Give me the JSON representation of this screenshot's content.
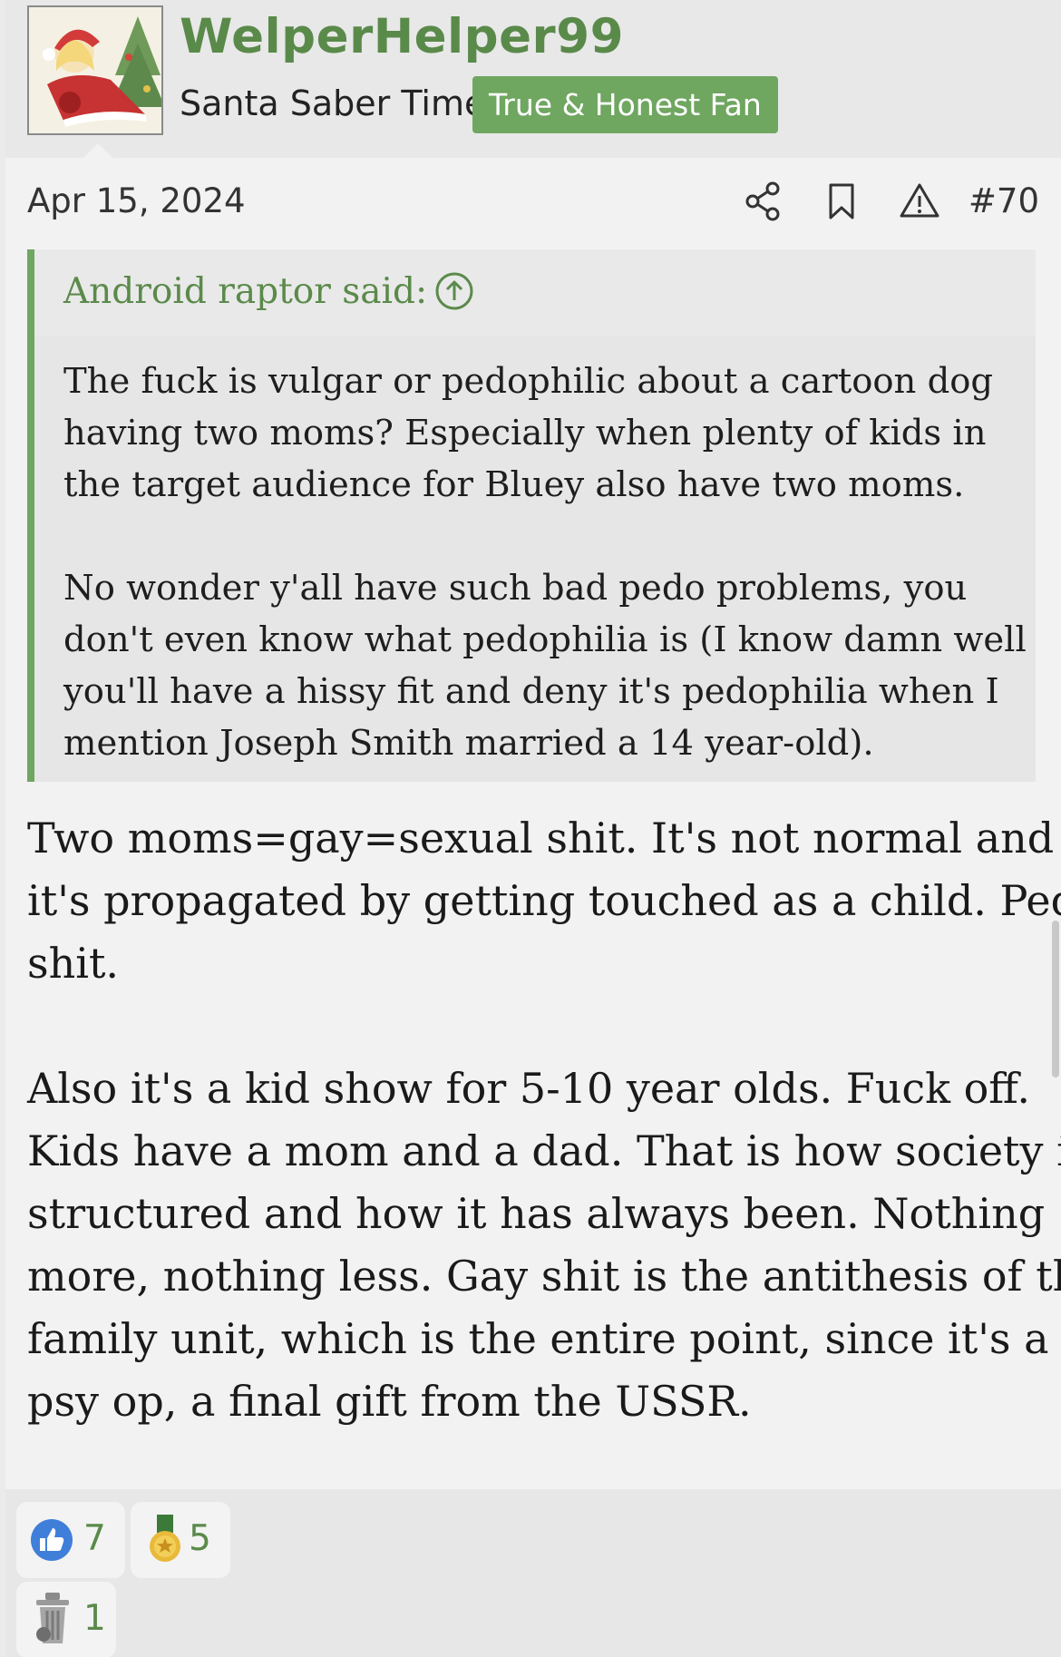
{
  "author": {
    "username": "WelperHelper99",
    "title": "Santa Saber Time",
    "banner": "True & Honest Fan",
    "avatar_icon": "santa-saber-avatar"
  },
  "post": {
    "date": "Apr 15, 2024",
    "number": "#70",
    "actions": [
      "share-icon",
      "bookmark-icon",
      "report-icon"
    ]
  },
  "quote": {
    "attribution": "Android raptor said:",
    "lines": [
      "The fuck is vulgar or pedophilic about a cartoon dog",
      "having two moms? Especially when plenty of kids in",
      "the target audience for Bluey also have two moms.",
      "",
      "No wonder y'all have such bad pedo problems, you",
      "don't even know what pedophilia is (I know damn well",
      "you'll have a hissy fit and deny it's pedophilia when I",
      "mention Joseph Smith married a 14 year-old)."
    ]
  },
  "message": {
    "lines": [
      "Two moms=gay=sexual shit. It's not normal and",
      "it's propagated by getting touched as a child. Pedo",
      "shit.",
      "",
      "Also it's a kid show for 5-10 year olds. Fuck off.",
      "Kids have a mom and a dad. That is how society is",
      "structured and how it has always been. Nothing",
      "more, nothing less. Gay shit is the antithesis of the",
      "family unit, which is the entire point, since it's a",
      "psy op, a final gift from the USSR."
    ]
  },
  "reactions": [
    {
      "icon": "thumbs-up-icon",
      "count": "7"
    },
    {
      "icon": "medal-icon",
      "count": "5"
    },
    {
      "icon": "trash-can-icon",
      "count": "1"
    }
  ],
  "colors": {
    "accent_green": "#5a8a4a",
    "banner_green": "#6fa660",
    "like_blue": "#3f7fd9"
  }
}
